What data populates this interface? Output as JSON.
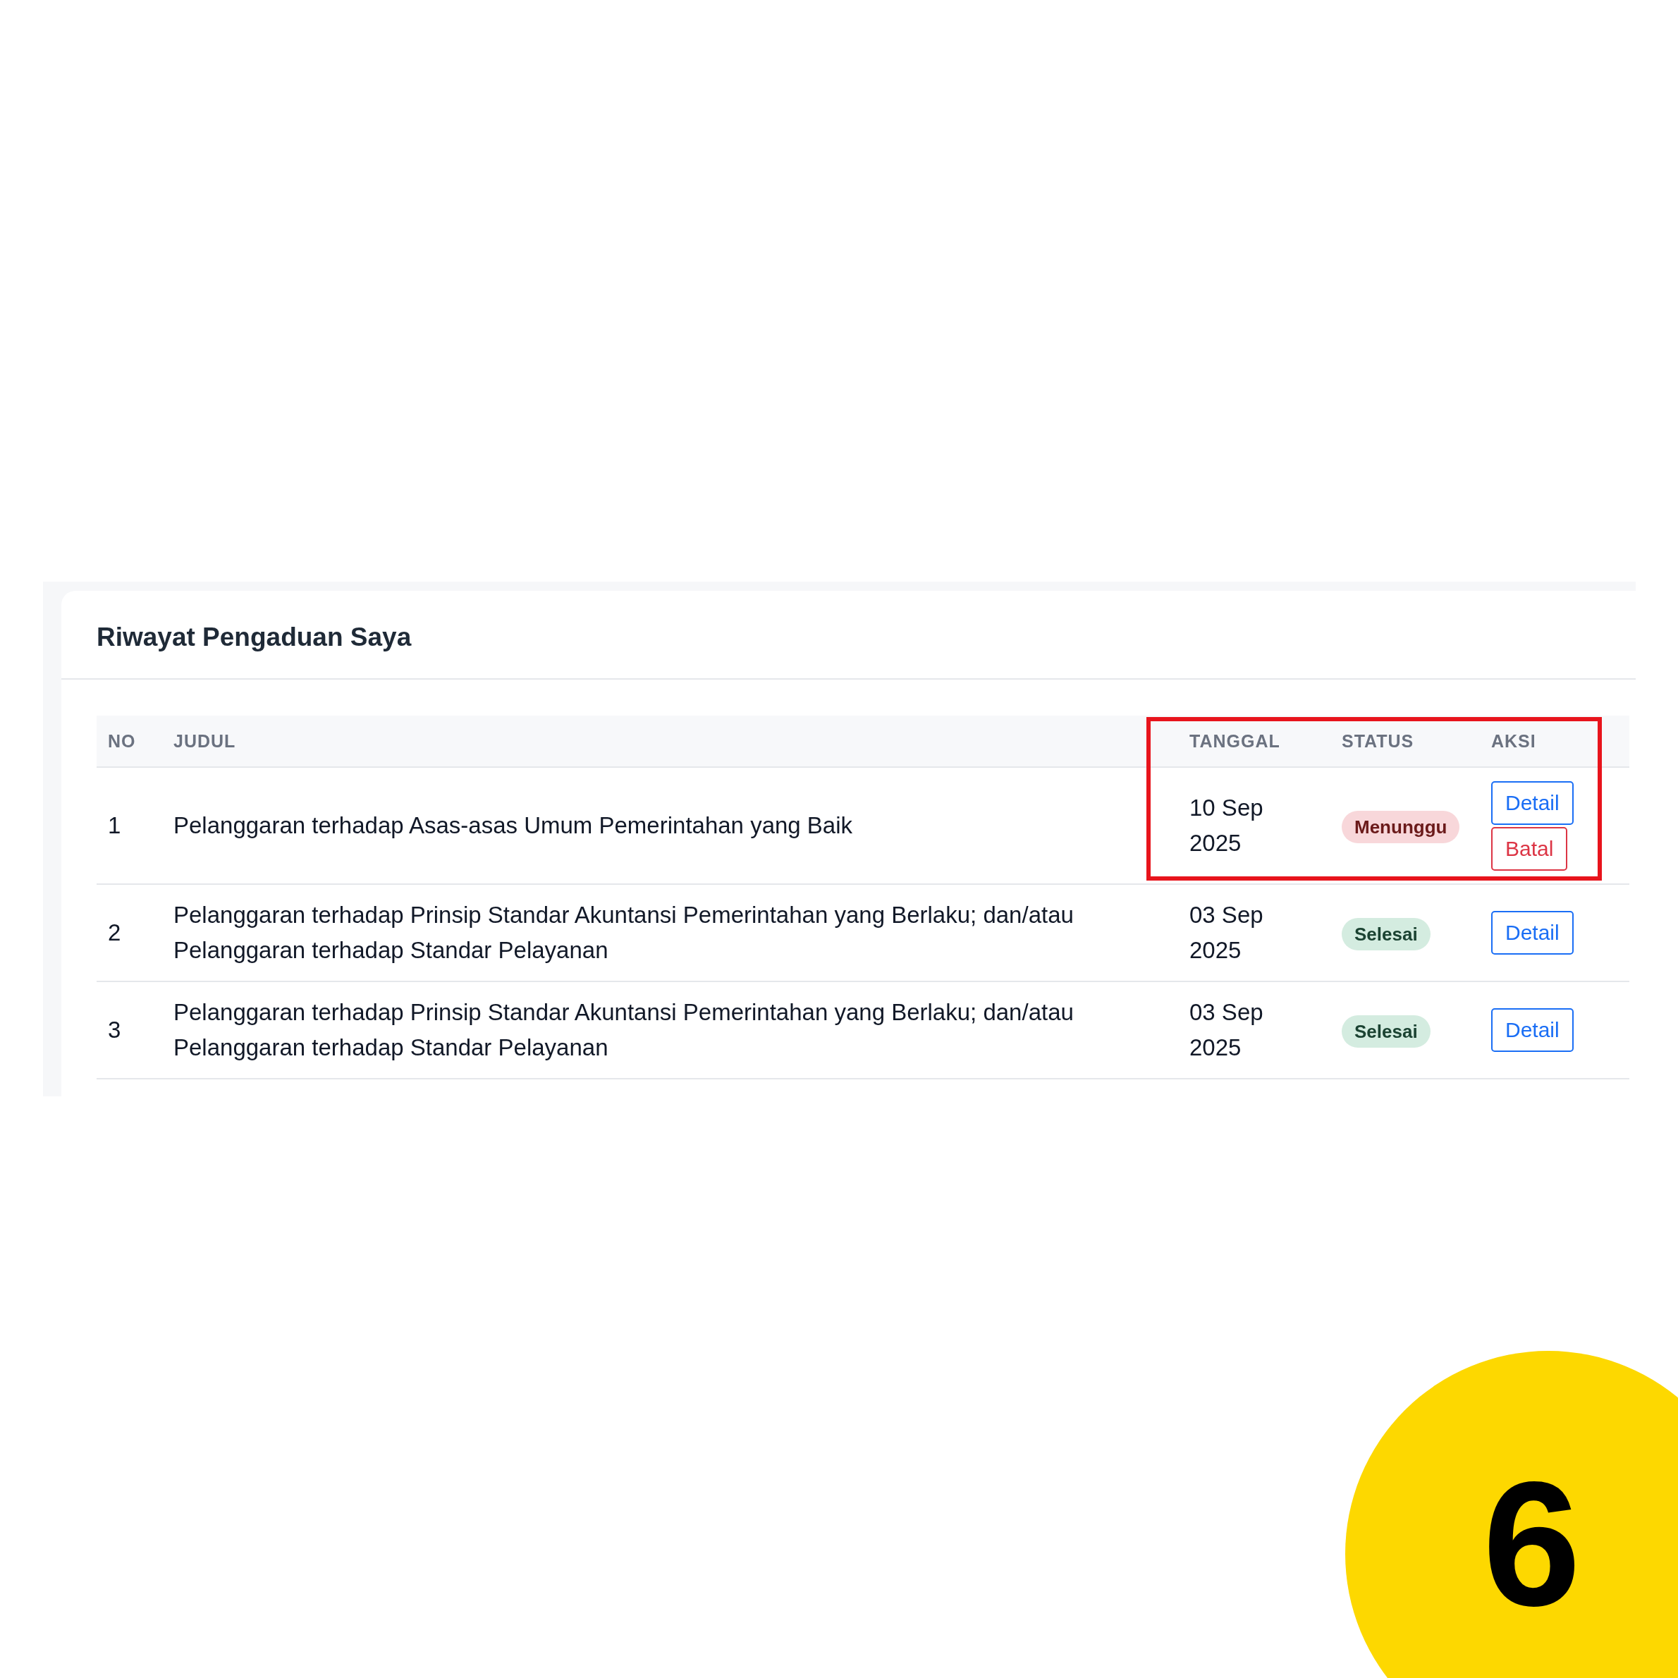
{
  "card": {
    "title": "Riwayat Pengaduan Saya"
  },
  "table": {
    "columns": [
      "NO",
      "JUDUL",
      "TANGGAL",
      "STATUS",
      "AKSI"
    ],
    "rows": [
      {
        "no": "1",
        "title": "Pelanggaran terhadap Asas-asas Umum Pemerintahan yang Baik",
        "date": "10 Sep 2025",
        "status": {
          "label": "Menunggu",
          "kind": "pending"
        },
        "actions": [
          {
            "label": "Detail",
            "kind": "primary"
          },
          {
            "label": "Batal",
            "kind": "danger"
          }
        ]
      },
      {
        "no": "2",
        "title": "Pelanggaran terhadap Prinsip Standar Akuntansi Pemerintahan yang Berlaku; dan/atau Pelanggaran terhadap Standar Pelayanan",
        "date": "03 Sep 2025",
        "status": {
          "label": "Selesai",
          "kind": "done"
        },
        "actions": [
          {
            "label": "Detail",
            "kind": "primary"
          }
        ]
      },
      {
        "no": "3",
        "title": "Pelanggaran terhadap Prinsip Standar Akuntansi Pemerintahan yang Berlaku; dan/atau Pelanggaran terhadap Standar Pelayanan",
        "date": "03 Sep 2025",
        "status": {
          "label": "Selesai",
          "kind": "done"
        },
        "actions": [
          {
            "label": "Detail",
            "kind": "primary"
          }
        ]
      }
    ]
  },
  "step_badge": "6"
}
